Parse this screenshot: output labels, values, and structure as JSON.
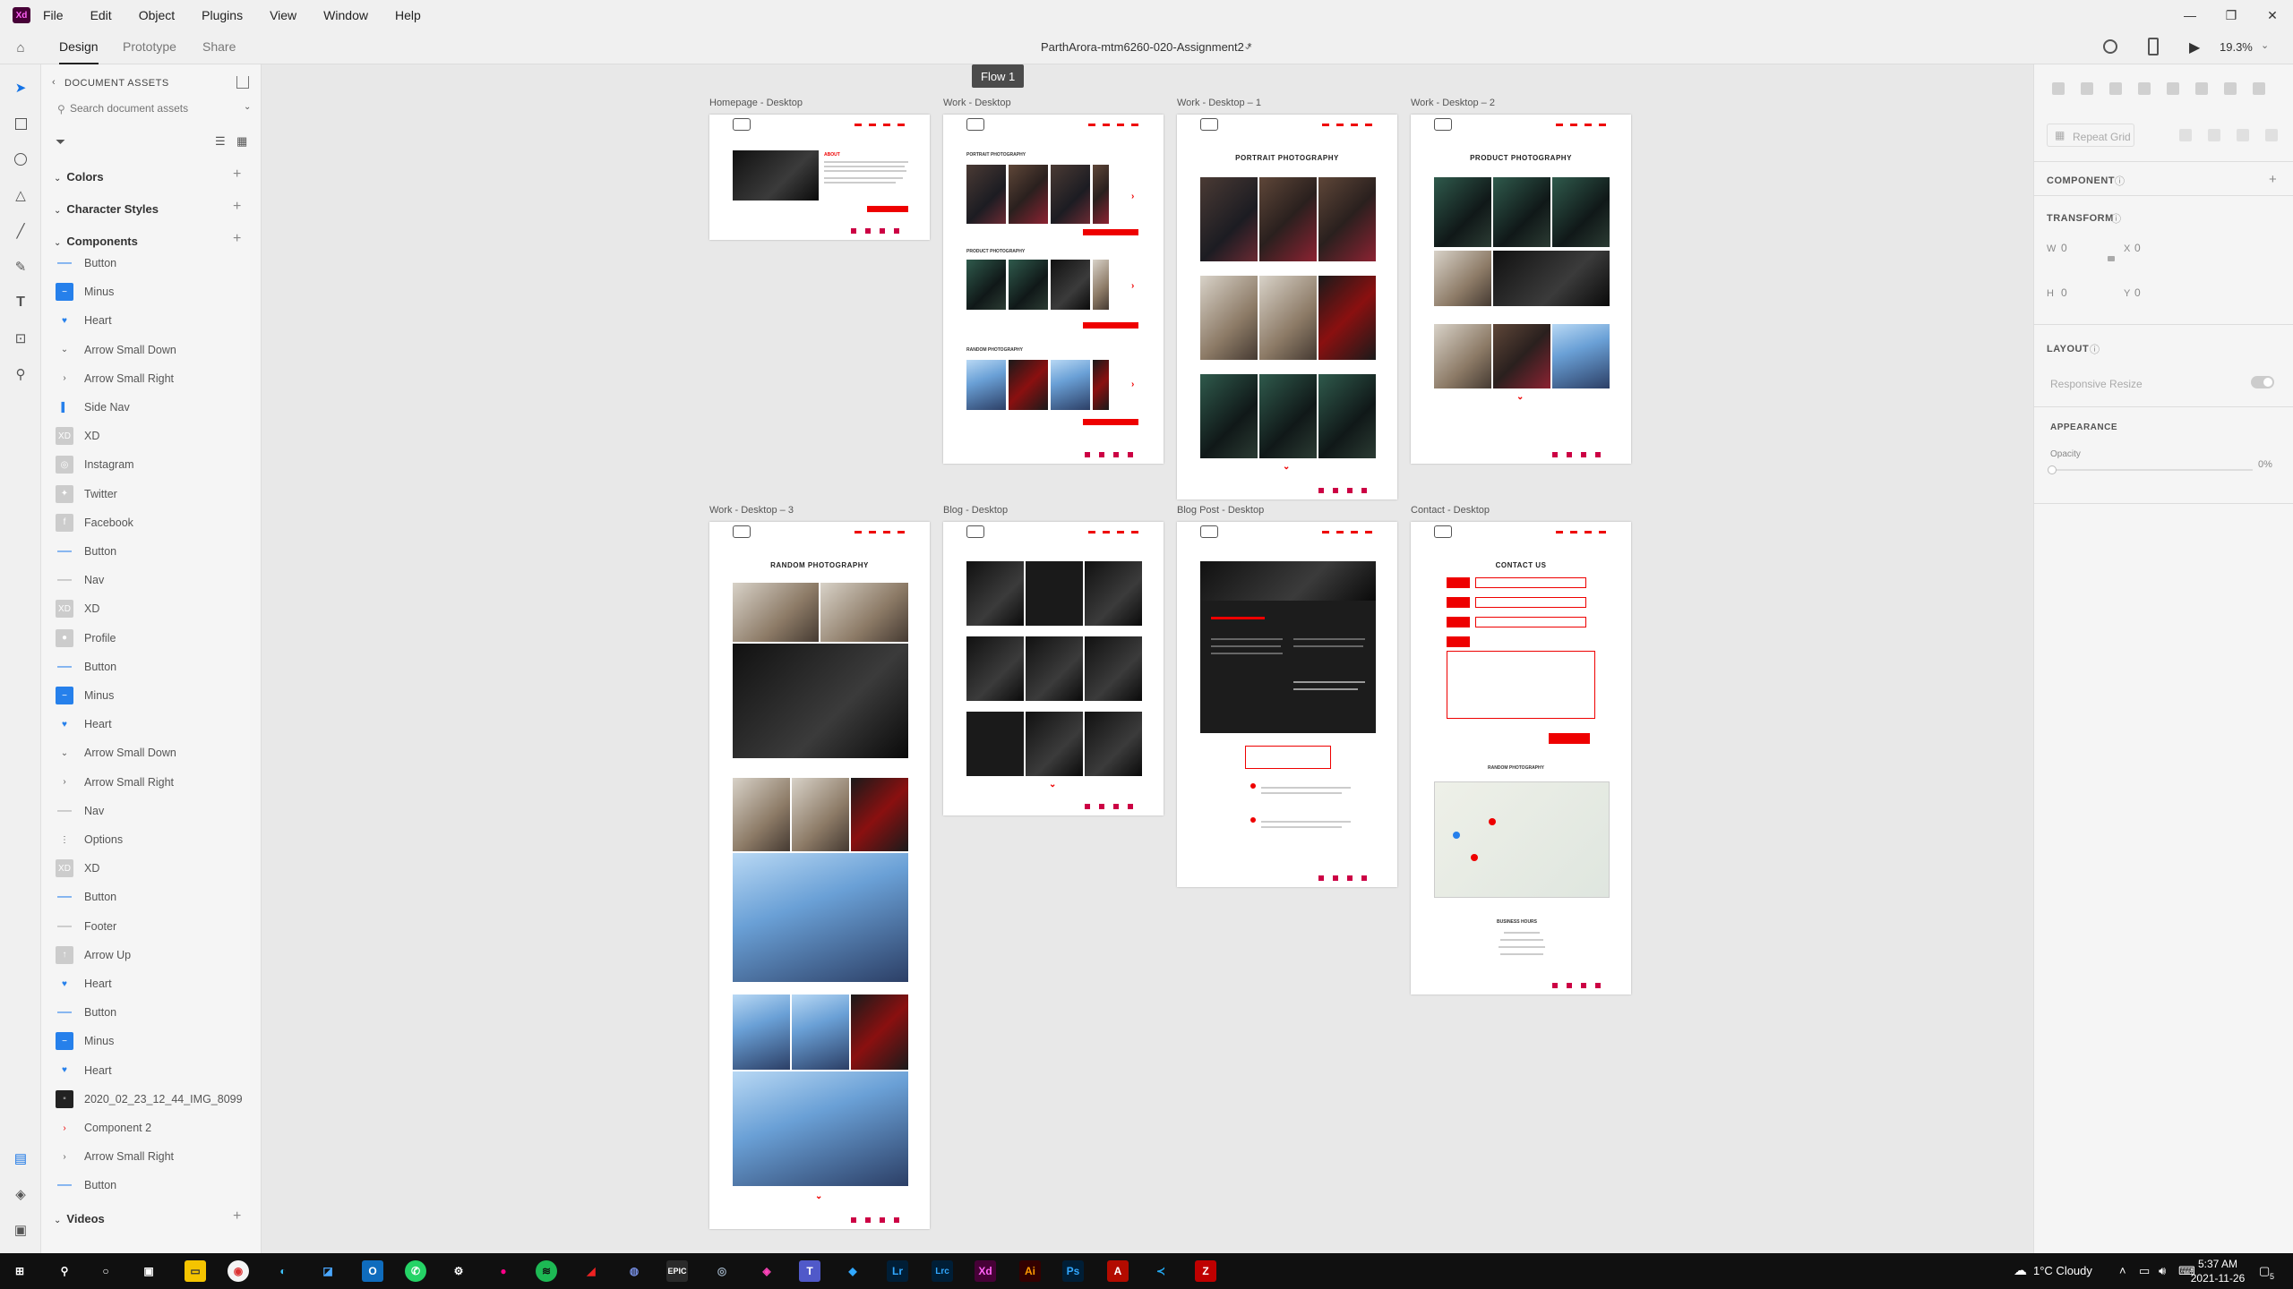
{
  "menubar": {
    "logo": "Xd",
    "items": [
      "File",
      "Edit",
      "Object",
      "Plugins",
      "View",
      "Window",
      "Help"
    ]
  },
  "appbar": {
    "tabs": [
      "Design",
      "Prototype",
      "Share"
    ],
    "document_title": "ParthArora-mtm6260-020-Assignment2 *",
    "zoom": "19.3%"
  },
  "assets": {
    "header": "DOCUMENT ASSETS",
    "search_placeholder": "Search document assets",
    "colors_label": "Colors",
    "character_styles_label": "Character Styles",
    "components_label": "Components",
    "videos_label": "Videos",
    "components": [
      {
        "label": "Button",
        "icon": "dash-icon"
      },
      {
        "label": "Minus",
        "icon": "minus-icon"
      },
      {
        "label": "Heart",
        "icon": "heart-icon"
      },
      {
        "label": "Arrow Small Down",
        "icon": "chevron-down-icon"
      },
      {
        "label": "Arrow Small Right",
        "icon": "chevron-right-icon"
      },
      {
        "label": "Side Nav",
        "icon": "bar-icon"
      },
      {
        "label": "XD",
        "icon": "xd-icon"
      },
      {
        "label": "Instagram",
        "icon": "instagram-icon"
      },
      {
        "label": "Twitter",
        "icon": "twitter-icon"
      },
      {
        "label": "Facebook",
        "icon": "facebook-icon"
      },
      {
        "label": "Button",
        "icon": "dash-icon"
      },
      {
        "label": "Nav",
        "icon": "line-icon"
      },
      {
        "label": "XD",
        "icon": "xd-icon"
      },
      {
        "label": "Profile",
        "icon": "profile-icon"
      },
      {
        "label": "Button",
        "icon": "dash-icon"
      },
      {
        "label": "Minus",
        "icon": "minus-icon"
      },
      {
        "label": "Heart",
        "icon": "heart-icon"
      },
      {
        "label": "Arrow Small Down",
        "icon": "chevron-down-icon"
      },
      {
        "label": "Arrow Small Right",
        "icon": "chevron-right-icon"
      },
      {
        "label": "Nav",
        "icon": "line-icon"
      },
      {
        "label": "Options",
        "icon": "options-icon"
      },
      {
        "label": "XD",
        "icon": "xd-icon"
      },
      {
        "label": "Button",
        "icon": "dash-icon"
      },
      {
        "label": "Footer",
        "icon": "line-icon"
      },
      {
        "label": "Arrow Up",
        "icon": "arrow-up-icon"
      },
      {
        "label": "Heart",
        "icon": "heart-icon"
      },
      {
        "label": "Button",
        "icon": "dash-icon"
      },
      {
        "label": "Minus",
        "icon": "minus-icon"
      },
      {
        "label": "Heart",
        "icon": "heart-icon"
      },
      {
        "label": "2020_02_23_12_44_IMG_8099",
        "icon": "image-icon"
      },
      {
        "label": "Component 2",
        "icon": "red-chevron-icon"
      },
      {
        "label": "Arrow Small Right",
        "icon": "chevron-right-icon"
      },
      {
        "label": "Button",
        "icon": "dash-icon"
      }
    ]
  },
  "canvas": {
    "flow_label": "Flow 1",
    "artboards": [
      "Homepage - Desktop",
      "Work - Desktop",
      "Work - Desktop – 1",
      "Work - Desktop – 2",
      "Work - Desktop – 3",
      "Blog - Desktop",
      "Blog Post - Desktop",
      "Contact - Desktop"
    ],
    "headings": {
      "about": "ABOUT",
      "portrait": "PORTRAIT PHOTOGRAPHY",
      "product": "PRODUCT PHOTOGRAPHY",
      "random": "RANDOM PHOTOGRAPHY",
      "contact": "CONTACT US",
      "business_hours": "BUSINESS HOURS"
    }
  },
  "properties": {
    "repeat_grid": "Repeat Grid",
    "component": "COMPONENT",
    "transform": "TRANSFORM",
    "w_label": "W",
    "w_value": "0",
    "x_label": "X",
    "x_value": "0",
    "h_label": "H",
    "h_value": "0",
    "y_label": "Y",
    "y_value": "0",
    "layout": "LAYOUT",
    "responsive_resize": "Responsive Resize",
    "appearance": "APPEARANCE",
    "opacity_label": "Opacity",
    "opacity_value": "0%"
  },
  "taskbar": {
    "weather": "1°C  Cloudy",
    "time": "5:37 AM",
    "date": "2021-11-26",
    "notifications": "5",
    "apps": [
      "Ai",
      "Ps",
      "Lr",
      "Lrc",
      "Xd",
      "EPIC"
    ]
  },
  "colors": {
    "accent_red": "#e00000",
    "component_blue": "#2680eb",
    "xd_purple": "#470137"
  }
}
